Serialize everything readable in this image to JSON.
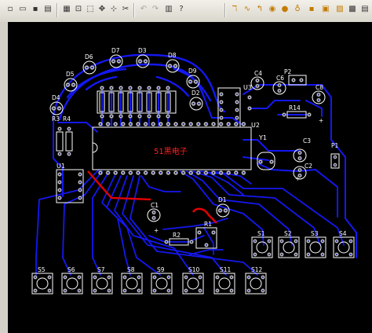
{
  "toolbar": {
    "icons": [
      "new-file",
      "open-folder",
      "save",
      "print",
      "print-preview",
      "zoom-fit",
      "zoom-area",
      "move",
      "select-box",
      "cut",
      "undo",
      "redo",
      "browse",
      "help"
    ],
    "right_icons": [
      "route-track",
      "arc",
      "via",
      "pad",
      "component",
      "string",
      "fill",
      "polygon",
      "keepout"
    ]
  },
  "pcb": {
    "title_text": "51黑电子",
    "leds": [
      "D6",
      "D7",
      "D3",
      "D8",
      "D5",
      "D9",
      "D4",
      "D2",
      "D1"
    ],
    "resistors": [
      "R3",
      "R4",
      "R1",
      "R2",
      "R14"
    ],
    "caps": [
      "C4",
      "C6",
      "C8",
      "C3",
      "C2",
      "C1"
    ],
    "ics": [
      "U1",
      "U2",
      "U3"
    ],
    "crystal": "Y1",
    "power": "P2",
    "connector": "P1",
    "switches_row1": [
      "S1",
      "S2",
      "S3",
      "S4"
    ],
    "switches_row2": [
      "S5",
      "S6",
      "S7",
      "S8",
      "S9",
      "S10",
      "S11",
      "S12"
    ],
    "pot_label": "R1",
    "plus": "+"
  },
  "colors": {
    "trace": "#1418f0",
    "route": "#e00000",
    "silk": "#ffffff",
    "pad": "#c8c8c8",
    "background": "#000000"
  }
}
